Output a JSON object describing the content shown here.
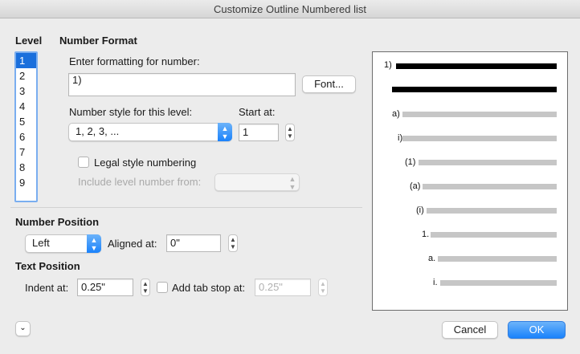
{
  "window": {
    "title": "Customize Outline Numbered list"
  },
  "level": {
    "heading": "Level",
    "items": [
      "1",
      "2",
      "3",
      "4",
      "5",
      "6",
      "7",
      "8",
      "9"
    ],
    "selected": "1"
  },
  "number_format": {
    "heading": "Number Format",
    "enter_label": "Enter formatting for number:",
    "format_value": "1)",
    "font_button": "Font...",
    "style_label": "Number style for this level:",
    "style_value": "1, 2, 3, ...",
    "start_label": "Start at:",
    "start_value": "1",
    "legal_label": "Legal style numbering",
    "include_label": "Include level number from:",
    "include_value": ""
  },
  "number_position": {
    "heading": "Number Position",
    "alignment_value": "Left",
    "aligned_label": "Aligned at:",
    "aligned_value": "0\""
  },
  "text_position": {
    "heading": "Text Position",
    "indent_label": "Indent at:",
    "indent_value": "0.25\"",
    "tabstop_label": "Add tab stop at:",
    "tabstop_value": "0.25\""
  },
  "preview": {
    "labels": [
      "1)",
      "a)",
      "i)",
      "(1)",
      "(a)",
      "(i)",
      "1.",
      "a.",
      "i."
    ]
  },
  "buttons": {
    "cancel": "Cancel",
    "ok": "OK"
  },
  "colors": {
    "accent": "#1a82fb",
    "selection": "#1a6fdc"
  }
}
